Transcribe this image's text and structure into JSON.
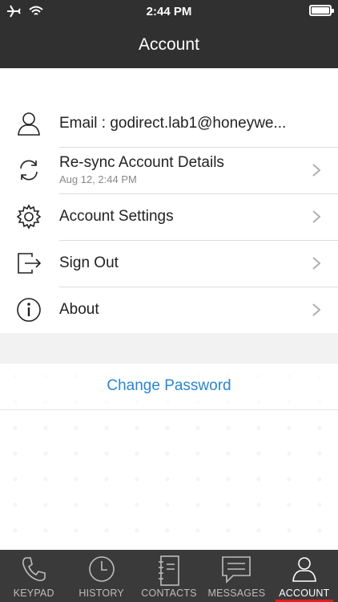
{
  "status_bar": {
    "time": "2:44 PM"
  },
  "header": {
    "title": "Account"
  },
  "menu": [
    {
      "label": "Email : godirect.lab1@honeywe...",
      "icon": "user-icon"
    },
    {
      "label": "Re-sync Account Details",
      "sublabel": "Aug 12, 2:44 PM",
      "icon": "sync-icon"
    },
    {
      "label": "Account Settings",
      "icon": "gear-icon"
    },
    {
      "label": "Sign Out",
      "icon": "sign-out-icon"
    },
    {
      "label": "About",
      "icon": "info-icon"
    }
  ],
  "change_password": "Change Password",
  "tabs": [
    {
      "label": "KEYPAD",
      "icon": "phone-icon"
    },
    {
      "label": "HISTORY",
      "icon": "clock-icon"
    },
    {
      "label": "CONTACTS",
      "icon": "contacts-book-icon"
    },
    {
      "label": "MESSAGES",
      "icon": "message-bubble-icon"
    },
    {
      "label": "ACCOUNT",
      "icon": "user-icon",
      "active": true
    }
  ],
  "colors": {
    "header": "#303030",
    "tabbar": "#3a3a3a",
    "link": "#2a86d1",
    "active_underline": "#e02020"
  }
}
